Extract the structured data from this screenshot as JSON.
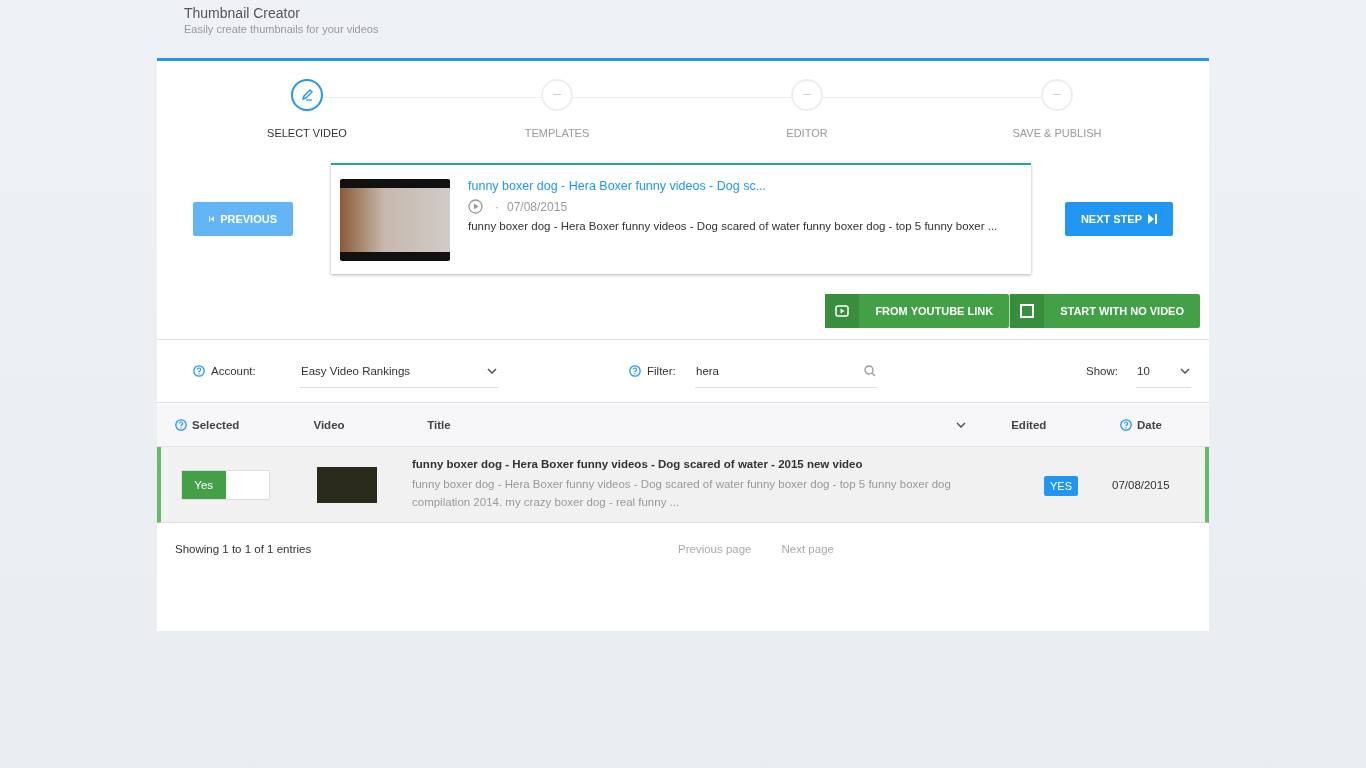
{
  "header": {
    "title": "Thumbnail Creator",
    "subtitle": "Easily create thumbnails for your videos"
  },
  "steps": [
    {
      "label": "SELECT VIDEO",
      "selected": true
    },
    {
      "label": "TEMPLATES",
      "selected": false
    },
    {
      "label": "EDITOR",
      "selected": false
    },
    {
      "label": "SAVE & PUBLISH",
      "selected": false
    }
  ],
  "previous_button": {
    "label": "PREVIOUS",
    "disabled": true
  },
  "next_button": {
    "label": "NEXT STEP",
    "disabled": false
  },
  "selected_video": {
    "title": "funny boxer dog - Hera Boxer funny videos - Dog sc...",
    "separator": "·",
    "date": "07/08/2015",
    "description": "funny boxer dog - Hera Boxer funny videos - Dog scared of water funny boxer dog - top 5 funny boxer ..."
  },
  "source_buttons": [
    {
      "kind": "youtube",
      "label": "FROM YOUTUBE LINK"
    },
    {
      "kind": "blank",
      "label": "START WITH NO VIDEO"
    }
  ],
  "filters": {
    "account_label": "Account:",
    "account_value": "Easy Video Rankings",
    "filter_label": "Filter:",
    "filter_value": "hera",
    "show_label": "Show:",
    "show_value": "10"
  },
  "table": {
    "columns": [
      {
        "label": "Selected",
        "help": true
      },
      {
        "label": "Video",
        "help": false
      },
      {
        "label": "Title",
        "help": false,
        "sortable": true
      },
      {
        "label": "Edited",
        "help": false
      },
      {
        "label": "Date",
        "help": true
      }
    ],
    "rows": [
      {
        "selected": true,
        "toggle_label": "Yes",
        "title": "funny boxer dog - Hera Boxer funny videos - Dog scared of water - 2015 new video",
        "description": "funny boxer dog - Hera Boxer funny videos - Dog scared of water funny boxer dog - top 5 funny boxer dog compilation 2014. my crazy boxer dog - real funny ...",
        "edited": "YES",
        "date": "07/08/2015"
      }
    ]
  },
  "footer": {
    "info": "Showing 1 to 1 of 1 entries",
    "previous_page": "Previous page",
    "next_page": "Next page"
  }
}
